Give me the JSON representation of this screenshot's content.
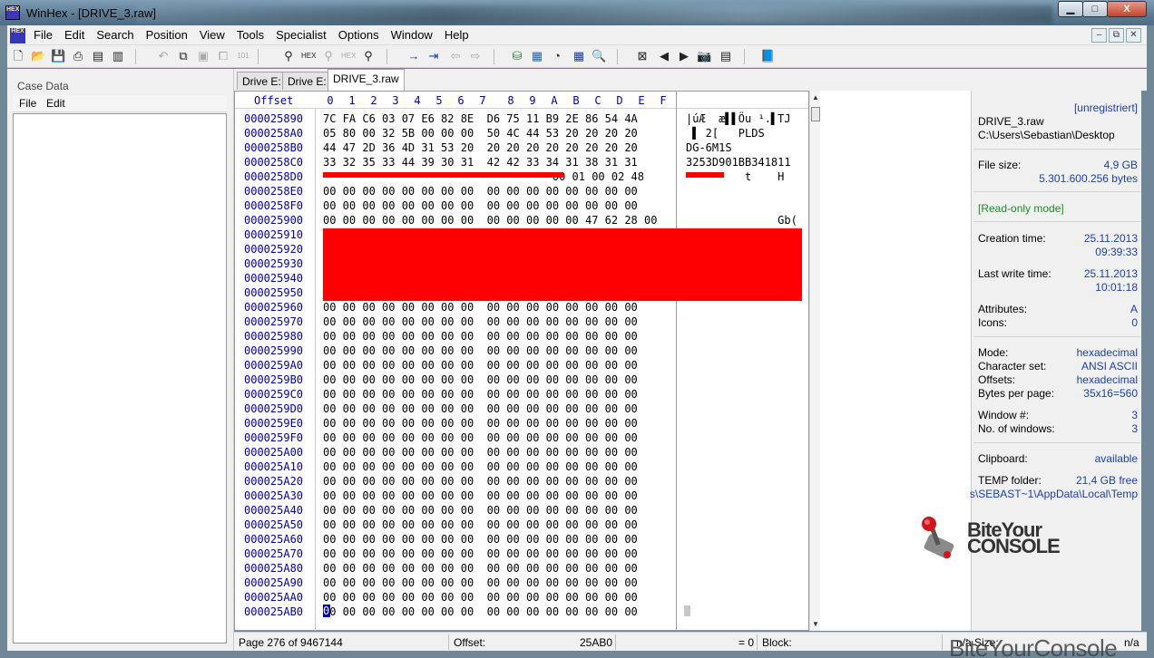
{
  "window": {
    "app_icon_text": "HEX",
    "title": "WinHex - [DRIVE_3.raw]",
    "min_glyph": "▁",
    "max_glyph": "□",
    "close_glyph": "X"
  },
  "menubar": {
    "items": [
      "File",
      "Edit",
      "Search",
      "Position",
      "View",
      "Tools",
      "Specialist",
      "Options",
      "Window",
      "Help"
    ],
    "mdi_buttons": [
      "–",
      "⧉",
      "✕"
    ]
  },
  "toolbar": {
    "icons": [
      "new-file-icon",
      "open-icon",
      "save-icon",
      "print-icon",
      "properties-icon",
      "copy-sectors-icon",
      "undo-icon",
      "copy-icon",
      "paste-icon",
      "paste-write-icon",
      "clipboard-icon",
      "hex-mode-icon",
      "find-text-icon",
      "find-hex-icon",
      "replace-text-icon",
      "replace-hex-icon",
      "find-next-icon",
      "goto-offset-icon",
      "goto-sector-icon",
      "back-icon",
      "forward-icon",
      "disk-editor-icon",
      "ram-editor-icon",
      "disk-icon",
      "calculator-icon",
      "search-icon",
      "first-icon",
      "prev-icon",
      "next-icon",
      "snapshot-icon",
      "table-icon",
      "help-book-icon"
    ]
  },
  "case_panel": {
    "title": "Case Data",
    "menu": [
      "File",
      "Edit"
    ]
  },
  "tabs": [
    {
      "label": "Drive E:",
      "active": false
    },
    {
      "label": "Drive E:",
      "active": false
    },
    {
      "label": "DRIVE_3.raw",
      "active": true
    }
  ],
  "hex_view": {
    "offset_label": "Offset",
    "columns": [
      "0",
      "1",
      "2",
      "3",
      "4",
      "5",
      "6",
      "7",
      "8",
      "9",
      "A",
      "B",
      "C",
      "D",
      "E",
      "F"
    ],
    "rows": [
      {
        "addr": "000025890",
        "hex": "7C FA C6 03 07 E6 82 8E  D6 75 11 B9 2E 86 54 4A",
        "ascii": "|úÆ  æ▌▌Öu ¹.▌TJ"
      },
      {
        "addr": "0000258A0",
        "hex": "05 80 00 32 5B 00 00 00  50 4C 44 53 20 20 20 20",
        "ascii": " ▌ 2[   PLDS"
      },
      {
        "addr": "0000258B0",
        "hex": "44 47 2D 36 4D 31 53 20  20 20 20 20 20 20 20 20",
        "ascii": "DG-6M1S"
      },
      {
        "addr": "0000258C0",
        "hex": "33 32 35 33 44 39 30 31  42 42 33 34 31 38 31 31",
        "ascii": "3253D901BB341811"
      },
      {
        "addr": "0000258D0",
        "hex": "                                   00 01 00 02 48",
        "ascii": "         t    H"
      },
      {
        "addr": "0000258E0",
        "hex": "00 00 00 00 00 00 00 00  00 00 00 00 00 00 00 00",
        "ascii": ""
      },
      {
        "addr": "0000258F0",
        "hex": "00 00 00 00 00 00 00 00  00 00 00 00 00 00 00 00",
        "ascii": ""
      },
      {
        "addr": "000025900",
        "hex": "00 00 00 00 00 00 00 00  00 00 00 00 00 47 62 28 00",
        "ascii": "              Gb("
      },
      {
        "addr": "000025910",
        "hex": "",
        "ascii": ""
      },
      {
        "addr": "000025920",
        "hex": "",
        "ascii": ""
      },
      {
        "addr": "000025930",
        "hex": "",
        "ascii": ""
      },
      {
        "addr": "000025940",
        "hex": "",
        "ascii": ""
      },
      {
        "addr": "000025950",
        "hex": "",
        "ascii": ""
      },
      {
        "addr": "000025960",
        "hex": "00 00 00 00 00 00 00 00  00 00 00 00 00 00 00 00",
        "ascii": ""
      },
      {
        "addr": "000025970",
        "hex": "00 00 00 00 00 00 00 00  00 00 00 00 00 00 00 00",
        "ascii": ""
      },
      {
        "addr": "000025980",
        "hex": "00 00 00 00 00 00 00 00  00 00 00 00 00 00 00 00",
        "ascii": ""
      },
      {
        "addr": "000025990",
        "hex": "00 00 00 00 00 00 00 00  00 00 00 00 00 00 00 00",
        "ascii": ""
      },
      {
        "addr": "0000259A0",
        "hex": "00 00 00 00 00 00 00 00  00 00 00 00 00 00 00 00",
        "ascii": ""
      },
      {
        "addr": "0000259B0",
        "hex": "00 00 00 00 00 00 00 00  00 00 00 00 00 00 00 00",
        "ascii": ""
      },
      {
        "addr": "0000259C0",
        "hex": "00 00 00 00 00 00 00 00  00 00 00 00 00 00 00 00",
        "ascii": ""
      },
      {
        "addr": "0000259D0",
        "hex": "00 00 00 00 00 00 00 00  00 00 00 00 00 00 00 00",
        "ascii": ""
      },
      {
        "addr": "0000259E0",
        "hex": "00 00 00 00 00 00 00 00  00 00 00 00 00 00 00 00",
        "ascii": ""
      },
      {
        "addr": "0000259F0",
        "hex": "00 00 00 00 00 00 00 00  00 00 00 00 00 00 00 00",
        "ascii": ""
      },
      {
        "addr": "000025A00",
        "hex": "00 00 00 00 00 00 00 00  00 00 00 00 00 00 00 00",
        "ascii": ""
      },
      {
        "addr": "000025A10",
        "hex": "00 00 00 00 00 00 00 00  00 00 00 00 00 00 00 00",
        "ascii": ""
      },
      {
        "addr": "000025A20",
        "hex": "00 00 00 00 00 00 00 00  00 00 00 00 00 00 00 00",
        "ascii": ""
      },
      {
        "addr": "000025A30",
        "hex": "00 00 00 00 00 00 00 00  00 00 00 00 00 00 00 00",
        "ascii": ""
      },
      {
        "addr": "000025A40",
        "hex": "00 00 00 00 00 00 00 00  00 00 00 00 00 00 00 00",
        "ascii": ""
      },
      {
        "addr": "000025A50",
        "hex": "00 00 00 00 00 00 00 00  00 00 00 00 00 00 00 00",
        "ascii": ""
      },
      {
        "addr": "000025A60",
        "hex": "00 00 00 00 00 00 00 00  00 00 00 00 00 00 00 00",
        "ascii": ""
      },
      {
        "addr": "000025A70",
        "hex": "00 00 00 00 00 00 00 00  00 00 00 00 00 00 00 00",
        "ascii": ""
      },
      {
        "addr": "000025A80",
        "hex": "00 00 00 00 00 00 00 00  00 00 00 00 00 00 00 00",
        "ascii": ""
      },
      {
        "addr": "000025A90",
        "hex": "00 00 00 00 00 00 00 00  00 00 00 00 00 00 00 00",
        "ascii": ""
      },
      {
        "addr": "000025AA0",
        "hex": "00 00 00 00 00 00 00 00  00 00 00 00 00 00 00 00",
        "ascii": ""
      },
      {
        "addr": "000025AB0",
        "hex": " 0 00 00 00 00 00 00 00  00 00 00 00 00 00 00 00",
        "ascii": ""
      }
    ],
    "cursor_char": "0",
    "redaction_color": "#ff0000"
  },
  "info_panel": {
    "registration": "[unregistriert]",
    "filename": "DRIVE_3.raw",
    "path": "C:\\Users\\Sebastian\\Desktop",
    "file_size_label": "File size:",
    "file_size_gb": "4,9 GB",
    "file_size_bytes": "5.301.600.256 bytes",
    "mode_note": "[Read-only mode]",
    "creation_label": "Creation time:",
    "creation_date": "25.11.2013",
    "creation_time": "09:39:33",
    "lastwrite_label": "Last write time:",
    "lastwrite_date": "25.11.2013",
    "lastwrite_time": "10:01:18",
    "attributes_label": "Attributes:",
    "attributes": "A",
    "icons_label": "Icons:",
    "icons": "0",
    "mode_label": "Mode:",
    "mode": "hexadecimal",
    "charset_label": "Character set:",
    "charset": "ANSI ASCII",
    "offsets_label": "Offsets:",
    "offsets": "hexadecimal",
    "bpp_label": "Bytes per page:",
    "bpp": "35x16=560",
    "window_label": "Window #:",
    "window": "3",
    "nwindows_label": "No. of windows:",
    "nwindows": "3",
    "clipboard_label": "Clipboard:",
    "clipboard": "available",
    "temp_label": "TEMP folder:",
    "temp_free": "21,4 GB free",
    "temp_path": "s\\SEBAST~1\\AppData\\Local\\Temp"
  },
  "watermark": {
    "line1": "BiteYour",
    "line2": "CONSOLE",
    "bottom": "BiteYourConsole"
  },
  "statusbar": {
    "page": "Page 276 of 9467144",
    "offset_label": "Offset:",
    "offset_value": "25AB0",
    "eq_value": "= 0",
    "block_label": "Block:",
    "size_label": "n/a  Size:",
    "size_value": "n/a"
  }
}
